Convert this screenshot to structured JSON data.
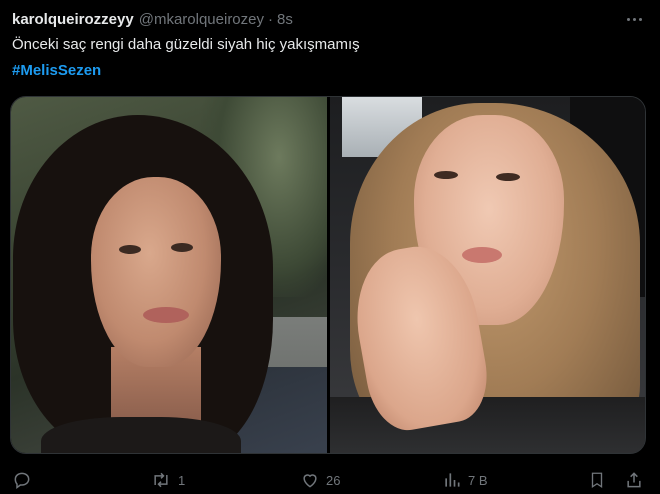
{
  "tweet": {
    "display_name": "karolqueirozzeyy",
    "handle": "@mkarolqueirozey",
    "separator": "·",
    "time": "8s",
    "text": "Önceki saç rengi daha güzeldi siyah hiç yakışmamış",
    "hashtag": "#MelisSezen"
  },
  "actions": {
    "reply_count": "",
    "retweet_count": "1",
    "like_count": "26",
    "views_count": "7 B"
  },
  "icons": [
    "more-icon",
    "reply-icon",
    "retweet-icon",
    "like-icon",
    "views-icon",
    "bookmark-icon",
    "share-icon"
  ],
  "colors": {
    "background": "#000000",
    "text": "#e7e9ea",
    "muted": "#71767b",
    "link": "#1d9bf0"
  }
}
